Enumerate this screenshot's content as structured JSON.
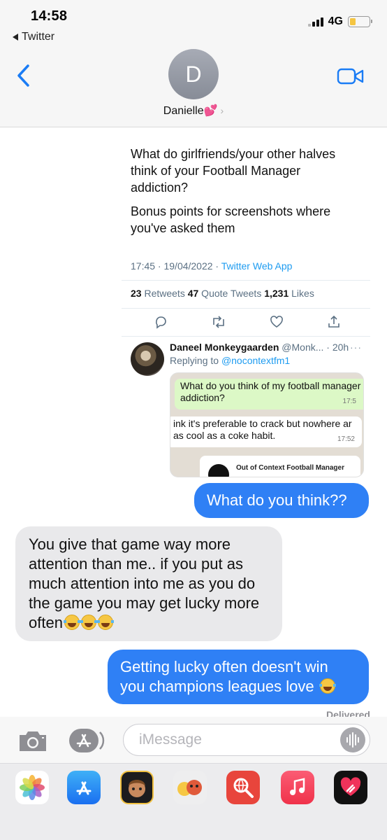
{
  "status_bar": {
    "time": "14:58",
    "back_app": "Twitter",
    "network": "4G"
  },
  "header": {
    "avatar_initial": "D",
    "contact_name": "Danielle💕",
    "chevron": "›"
  },
  "tweet": {
    "text_1": "What do girlfriends/your other halves think of your Football Manager addiction?",
    "text_2": "Bonus points for screenshots where you've asked them",
    "time_date": "17:45 · 19/04/2022 · ",
    "source": "Twitter Web App",
    "retweets": "23",
    "retweets_label": " Retweets  ",
    "quote_tweets": "47",
    "quote_tweets_label": " Quote Tweets  ",
    "likes": "1,231",
    "likes_label": " Likes",
    "reply": {
      "name": "Daneel Monkeygaarden",
      "handle": " @Monk... · 20h",
      "more": "···",
      "replying_to_label": "Replying to ",
      "replying_to": "@nocontextfm1",
      "screenshot": {
        "out_message": "What do you think of my football manager addiction?",
        "out_time": "17:5",
        "in_message": "ink it's preferable to crack but nowhere ar as cool as a coke habit.",
        "in_time": "17:52",
        "card_title": "Out of Context Football Manager"
      }
    }
  },
  "messages": [
    {
      "direction": "outgoing",
      "text": "What do you think??"
    },
    {
      "direction": "incoming",
      "text": "You give that game way more attention than me.. if you put as much attention into me as you do the game you may get lucky more often"
    },
    {
      "direction": "outgoing",
      "text": "Getting lucky often doesn't win you champions leagues love"
    }
  ],
  "delivered": "Delivered",
  "compose": {
    "placeholder": "iMessage"
  },
  "apps": [
    "photos-icon",
    "app-store-icon",
    "memoji-icon",
    "animoji-icon",
    "web-search-icon",
    "music-icon",
    "digital-touch-icon"
  ],
  "colors": {
    "imessage_blue": "#2f80f5",
    "incoming_gray": "#e9e9eb",
    "ios_blue": "#1a7cf5",
    "twitter_blue": "#1d9bf0"
  }
}
